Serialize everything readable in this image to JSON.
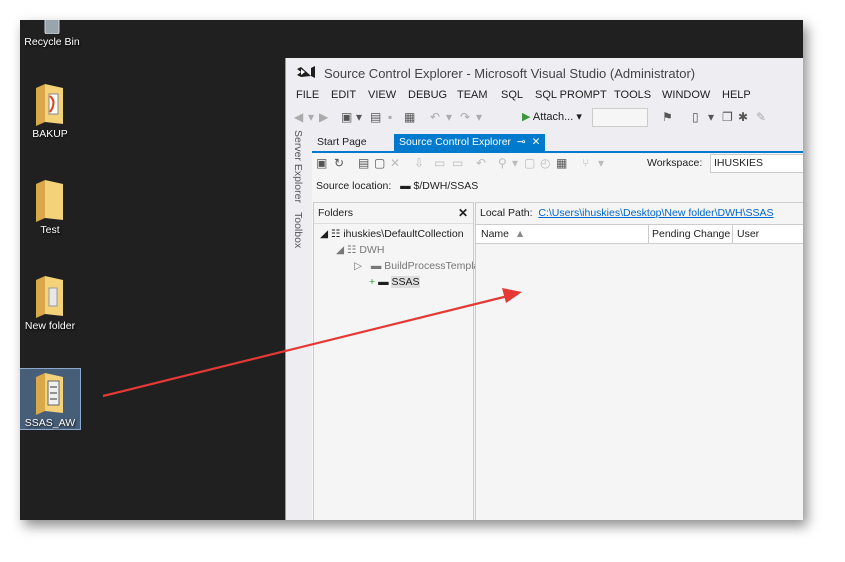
{
  "desktop": {
    "icons": [
      {
        "label": "Recycle Bin"
      },
      {
        "label": "BAKUP"
      },
      {
        "label": "Test"
      },
      {
        "label": "New folder"
      },
      {
        "label": "SSAS_AW"
      }
    ]
  },
  "window": {
    "title": "Source Control Explorer - Microsoft Visual Studio (Administrator)",
    "menu": [
      "FILE",
      "EDIT",
      "VIEW",
      "DEBUG",
      "TEAM",
      "SQL",
      "SQL PROMPT",
      "TOOLS",
      "WINDOW",
      "HELP"
    ],
    "toolbar": {
      "attach_label": "Attach...",
      "attach_dropdown": "▾"
    },
    "side_tabs": [
      "Server Explorer",
      "Toolbox"
    ],
    "doc_tabs": [
      {
        "label": "Start Page"
      },
      {
        "label": "Source Control Explorer",
        "pin": "⊸",
        "close": "✕"
      }
    ]
  },
  "source_control": {
    "workspace_label": "Workspace:",
    "workspace_value": "IHUSKIES",
    "source_location_label": "Source location:",
    "source_location_value": "$/DWH/SSAS",
    "folders_header": "Folders",
    "folders_close": "✕",
    "tree": [
      {
        "expander": "◢",
        "label": "ihuskies\\DefaultCollection"
      },
      {
        "expander": "◢",
        "label": "DWH"
      },
      {
        "expander": "▷",
        "label": "BuildProcessTemplates"
      },
      {
        "expander": "+",
        "label": "SSAS"
      }
    ],
    "local_path_label": "Local Path:",
    "local_path_value": "C:\\Users\\ihuskies\\Desktop\\New folder\\DWH\\SSAS",
    "columns": [
      {
        "label": "Name",
        "sort": "▲"
      },
      {
        "label": "Pending Change"
      },
      {
        "label": "User"
      }
    ]
  },
  "colors": {
    "accent": "#007acc",
    "arrow": "#e53935",
    "desktop": "#202020"
  }
}
